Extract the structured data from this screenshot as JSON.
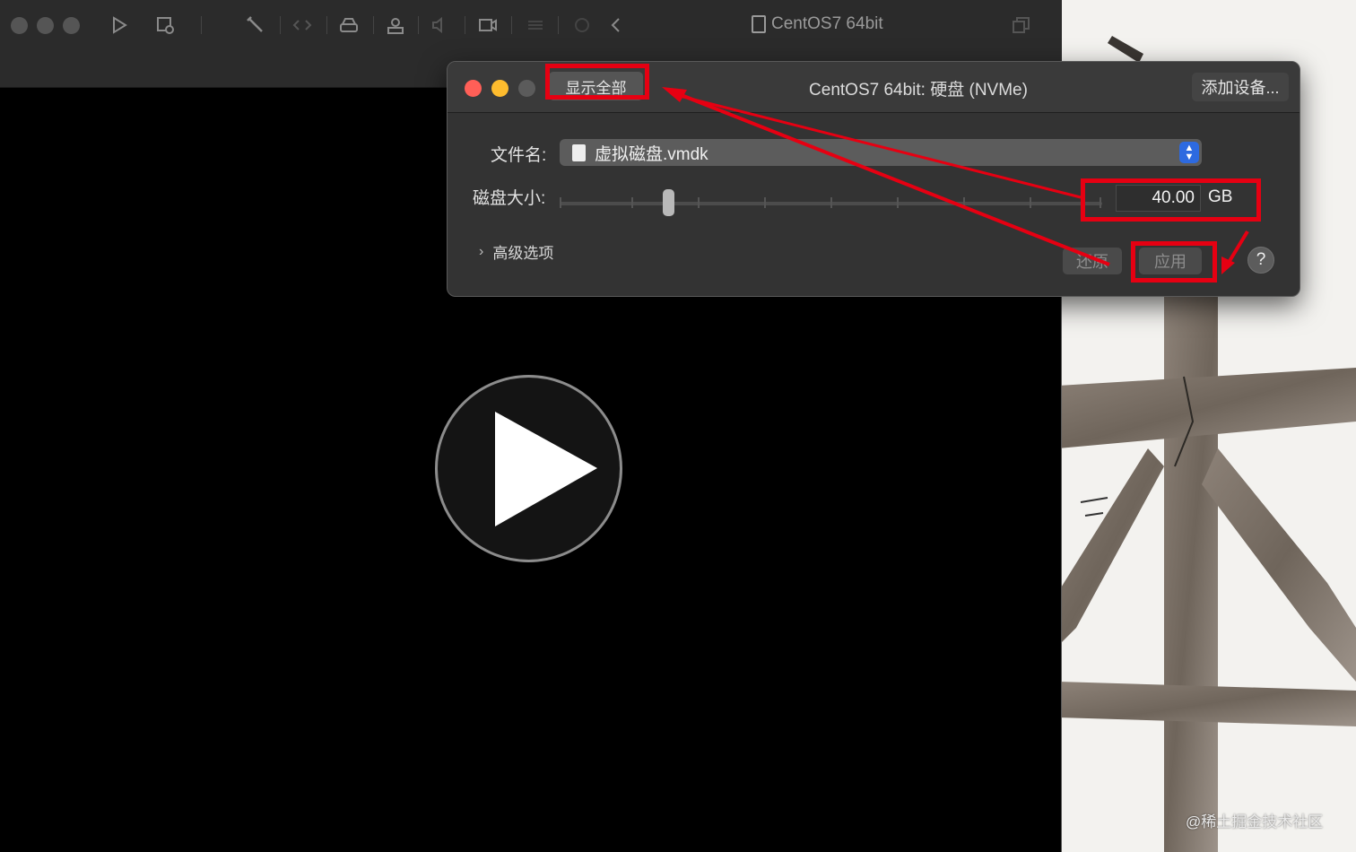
{
  "vm_window": {
    "title": "CentOS7 64bit",
    "toolbar_icons": [
      "play-icon",
      "snapshot-icon",
      "wrench-icon",
      "code-icon",
      "disk-icon",
      "user-icon",
      "speaker-icon",
      "camera-icon",
      "network-icon",
      "usb-icon",
      "back-icon",
      "restore-window-icon"
    ]
  },
  "dialog": {
    "show_all_label": "显示全部",
    "title": "CentOS7 64bit: 硬盘 (NVMe)",
    "add_device_label": "添加设备...",
    "file_name_label": "文件名:",
    "file_name_value": "虚拟磁盘.vmdk",
    "disk_size_label": "磁盘大小:",
    "disk_size_value": "40.00",
    "disk_size_unit": "GB",
    "disk_size_slider_fraction": 0.2,
    "advanced_label": "高级选项",
    "revert_label": "还原",
    "apply_label": "应用",
    "help_label": "?"
  },
  "colors": {
    "annotation": "#e60012",
    "close_light": "#ff5f57",
    "minimize_light": "#febc2e",
    "stepper_blue": "#2d6ae0"
  },
  "watermark": "@稀土掘金技术社区"
}
